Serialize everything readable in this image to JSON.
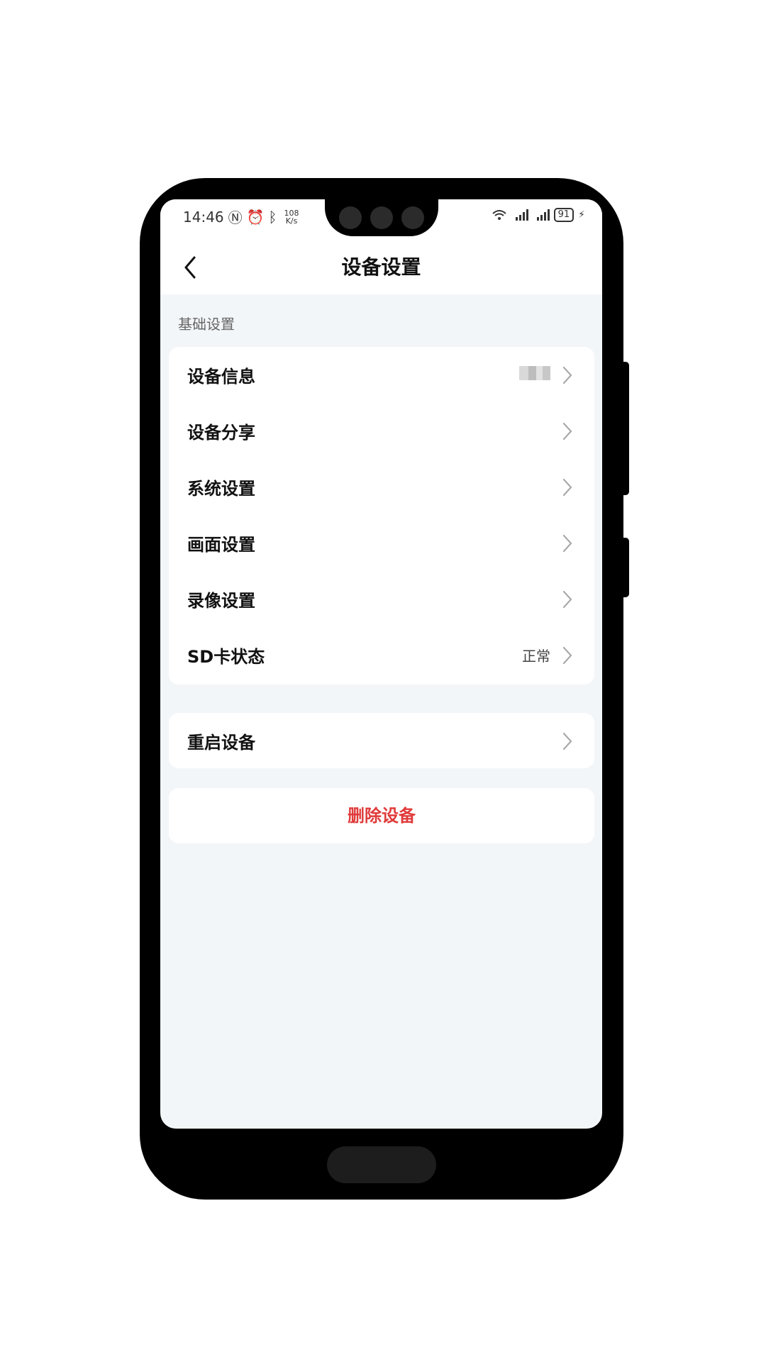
{
  "status_bar": {
    "time": "14:46",
    "speed_top": "108",
    "speed_bottom": "K/s",
    "battery": "91"
  },
  "nav": {
    "title": "设备设置"
  },
  "section_basic": {
    "label": "基础设置"
  },
  "settings": {
    "items": [
      {
        "label": "设备信息",
        "value": ""
      },
      {
        "label": "设备分享",
        "value": ""
      },
      {
        "label": "系统设置",
        "value": ""
      },
      {
        "label": "画面设置",
        "value": ""
      },
      {
        "label": "录像设置",
        "value": ""
      },
      {
        "label": "SD卡状态",
        "value": "正常"
      }
    ]
  },
  "reboot": {
    "label": "重启设备"
  },
  "delete": {
    "label": "删除设备"
  },
  "colors": {
    "danger": "#e03a3a",
    "background": "#f3f6f9",
    "card": "#ffffff"
  }
}
